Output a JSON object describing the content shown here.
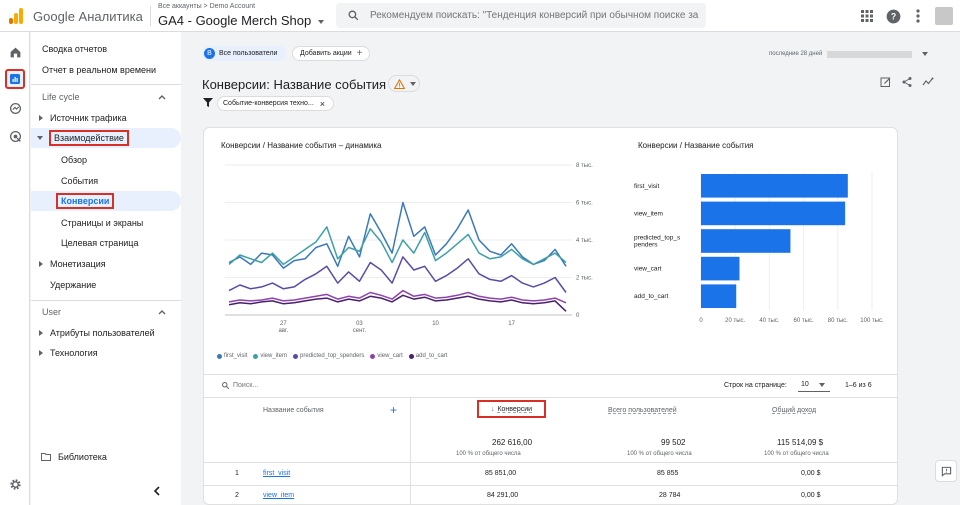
{
  "header": {
    "app_name": "Google Аналитика",
    "breadcrumb": "Все аккаунты > Demo Account",
    "property": "GA4 - Google Merch Shop",
    "search_placeholder": "Рекомендуем поискать: \"Тенденция конверсий при обычном поиске за ..."
  },
  "nav": {
    "items": [
      {
        "label": "Сводка отчетов"
      },
      {
        "label": "Отчет в реальном времени"
      },
      {
        "label": "Life cycle"
      },
      {
        "label": "Источник трафика"
      },
      {
        "label": "Взаимодействие"
      },
      {
        "label": "Обзор"
      },
      {
        "label": "События"
      },
      {
        "label": "Конверсии"
      },
      {
        "label": "Страницы и экраны"
      },
      {
        "label": "Целевая страница"
      },
      {
        "label": "Монетизация"
      },
      {
        "label": "Удержание"
      },
      {
        "label": "User"
      },
      {
        "label": "Атрибуты пользователей"
      },
      {
        "label": "Технология"
      }
    ],
    "library": "Библиотека"
  },
  "toolbar": {
    "segment_badge": "B",
    "segment": "Все пользователи",
    "add_comparison": "Добавить акции",
    "date_range_label": "последние 28 дней"
  },
  "page": {
    "title": "Конверсии: Название события",
    "filter": "Событие-конверсия техно..."
  },
  "colors": {
    "accent": "#1a73e8",
    "first_visit": "#3b78bd",
    "view_item": "#3ea0a6",
    "predicted_top_spenders": "#5c4aa8",
    "view_cart": "#8e44ad",
    "add_to_cart": "#4a1f6e",
    "bar": "#1a73e8"
  },
  "chart_data": [
    {
      "type": "line",
      "title": "Конверсии / Название события – динамика",
      "x_ticks": [
        "27 авг.",
        "03 сент.",
        "10",
        "17"
      ],
      "y_ticks": [
        "8 тыс.",
        "6 тыс.",
        "4 тыс.",
        "2 тыс.",
        "0"
      ],
      "ylim": [
        0,
        8000
      ],
      "series": [
        {
          "name": "first_visit",
          "color": "#3b78bd",
          "values": [
            2800,
            3100,
            2700,
            3300,
            3200,
            2500,
            2900,
            3000,
            3600,
            3800,
            2600,
            4200,
            3100,
            5400,
            4400,
            3300,
            6000,
            4200,
            4700,
            3200,
            3800,
            4600,
            5600,
            4000,
            3400,
            3200,
            3800,
            3100,
            2700,
            2900,
            3500,
            2600
          ]
        },
        {
          "name": "view_item",
          "color": "#3ea0a6",
          "values": [
            2700,
            3200,
            3000,
            2800,
            3300,
            2700,
            3100,
            3500,
            3900,
            4700,
            3000,
            3600,
            3400,
            4600,
            3900,
            2800,
            4000,
            3300,
            4400,
            2900,
            3300,
            3800,
            4300,
            3300,
            3000,
            3100,
            3500,
            3000,
            2700,
            3000,
            3300,
            2800
          ]
        },
        {
          "name": "predicted_top_spenders",
          "color": "#5c4aa8",
          "values": [
            1300,
            1600,
            1400,
            1500,
            1700,
            1400,
            1500,
            1900,
            2200,
            2600,
            1700,
            2300,
            1800,
            2800,
            2400,
            1700,
            3100,
            2400,
            2600,
            1800,
            2100,
            2500,
            3000,
            2200,
            1900,
            1800,
            2100,
            1700,
            1500,
            1700,
            2000,
            1200
          ]
        },
        {
          "name": "view_cart",
          "color": "#8e44ad",
          "values": [
            700,
            800,
            750,
            800,
            900,
            750,
            800,
            900,
            1000,
            1100,
            850,
            1000,
            900,
            1200,
            1050,
            850,
            1300,
            1000,
            1100,
            900,
            950,
            1050,
            1200,
            1000,
            900,
            850,
            950,
            800,
            750,
            800,
            900,
            650
          ]
        },
        {
          "name": "add_to_cart",
          "color": "#4a1f6e",
          "values": [
            550,
            650,
            600,
            700,
            750,
            600,
            650,
            750,
            850,
            900,
            700,
            850,
            750,
            1000,
            900,
            700,
            1050,
            850,
            950,
            750,
            800,
            900,
            1000,
            850,
            750,
            700,
            800,
            650,
            600,
            650,
            750,
            200
          ]
        }
      ]
    },
    {
      "type": "bar",
      "orientation": "horizontal",
      "title": "Конверсии / Название события",
      "categories": [
        "first_visit",
        "view_item",
        "predicted_top_spenders",
        "view_cart",
        "add_to_cart"
      ],
      "category_labels": [
        [
          "first_visit"
        ],
        [
          "view_item"
        ],
        [
          "predicted_top_s",
          "penders"
        ],
        [
          "view_cart"
        ],
        [
          "add_to_cart"
        ]
      ],
      "values": [
        85851,
        84291,
        52300,
        22500,
        20600
      ],
      "x_ticks": [
        "0",
        "20 тыс.",
        "40 тыс.",
        "60 тыс.",
        "80 тыс.",
        "100 тыс."
      ],
      "xlim": [
        0,
        100000
      ]
    }
  ],
  "table": {
    "search_placeholder": "Поиск...",
    "rows_per_page_label": "Строк на странице:",
    "rows_per_page": "10",
    "pagination": "1–6 из 6",
    "col_name": "Название события",
    "col_conv": "Конверсии",
    "col_users": "Всего пользователей",
    "col_revenue": "Общий доход",
    "total_conv": "262 616,00",
    "total_users": "99 502",
    "total_revenue": "115 514,09 $",
    "pct_label": "100 % от общего числа",
    "rows": [
      {
        "idx": "1",
        "name": "first_visit",
        "conv": "85 851,00",
        "users": "85 855",
        "revenue": "0,00 $"
      },
      {
        "idx": "2",
        "name": "view_item",
        "conv": "84 291,00",
        "users": "28 784",
        "revenue": "0,00 $"
      }
    ]
  }
}
